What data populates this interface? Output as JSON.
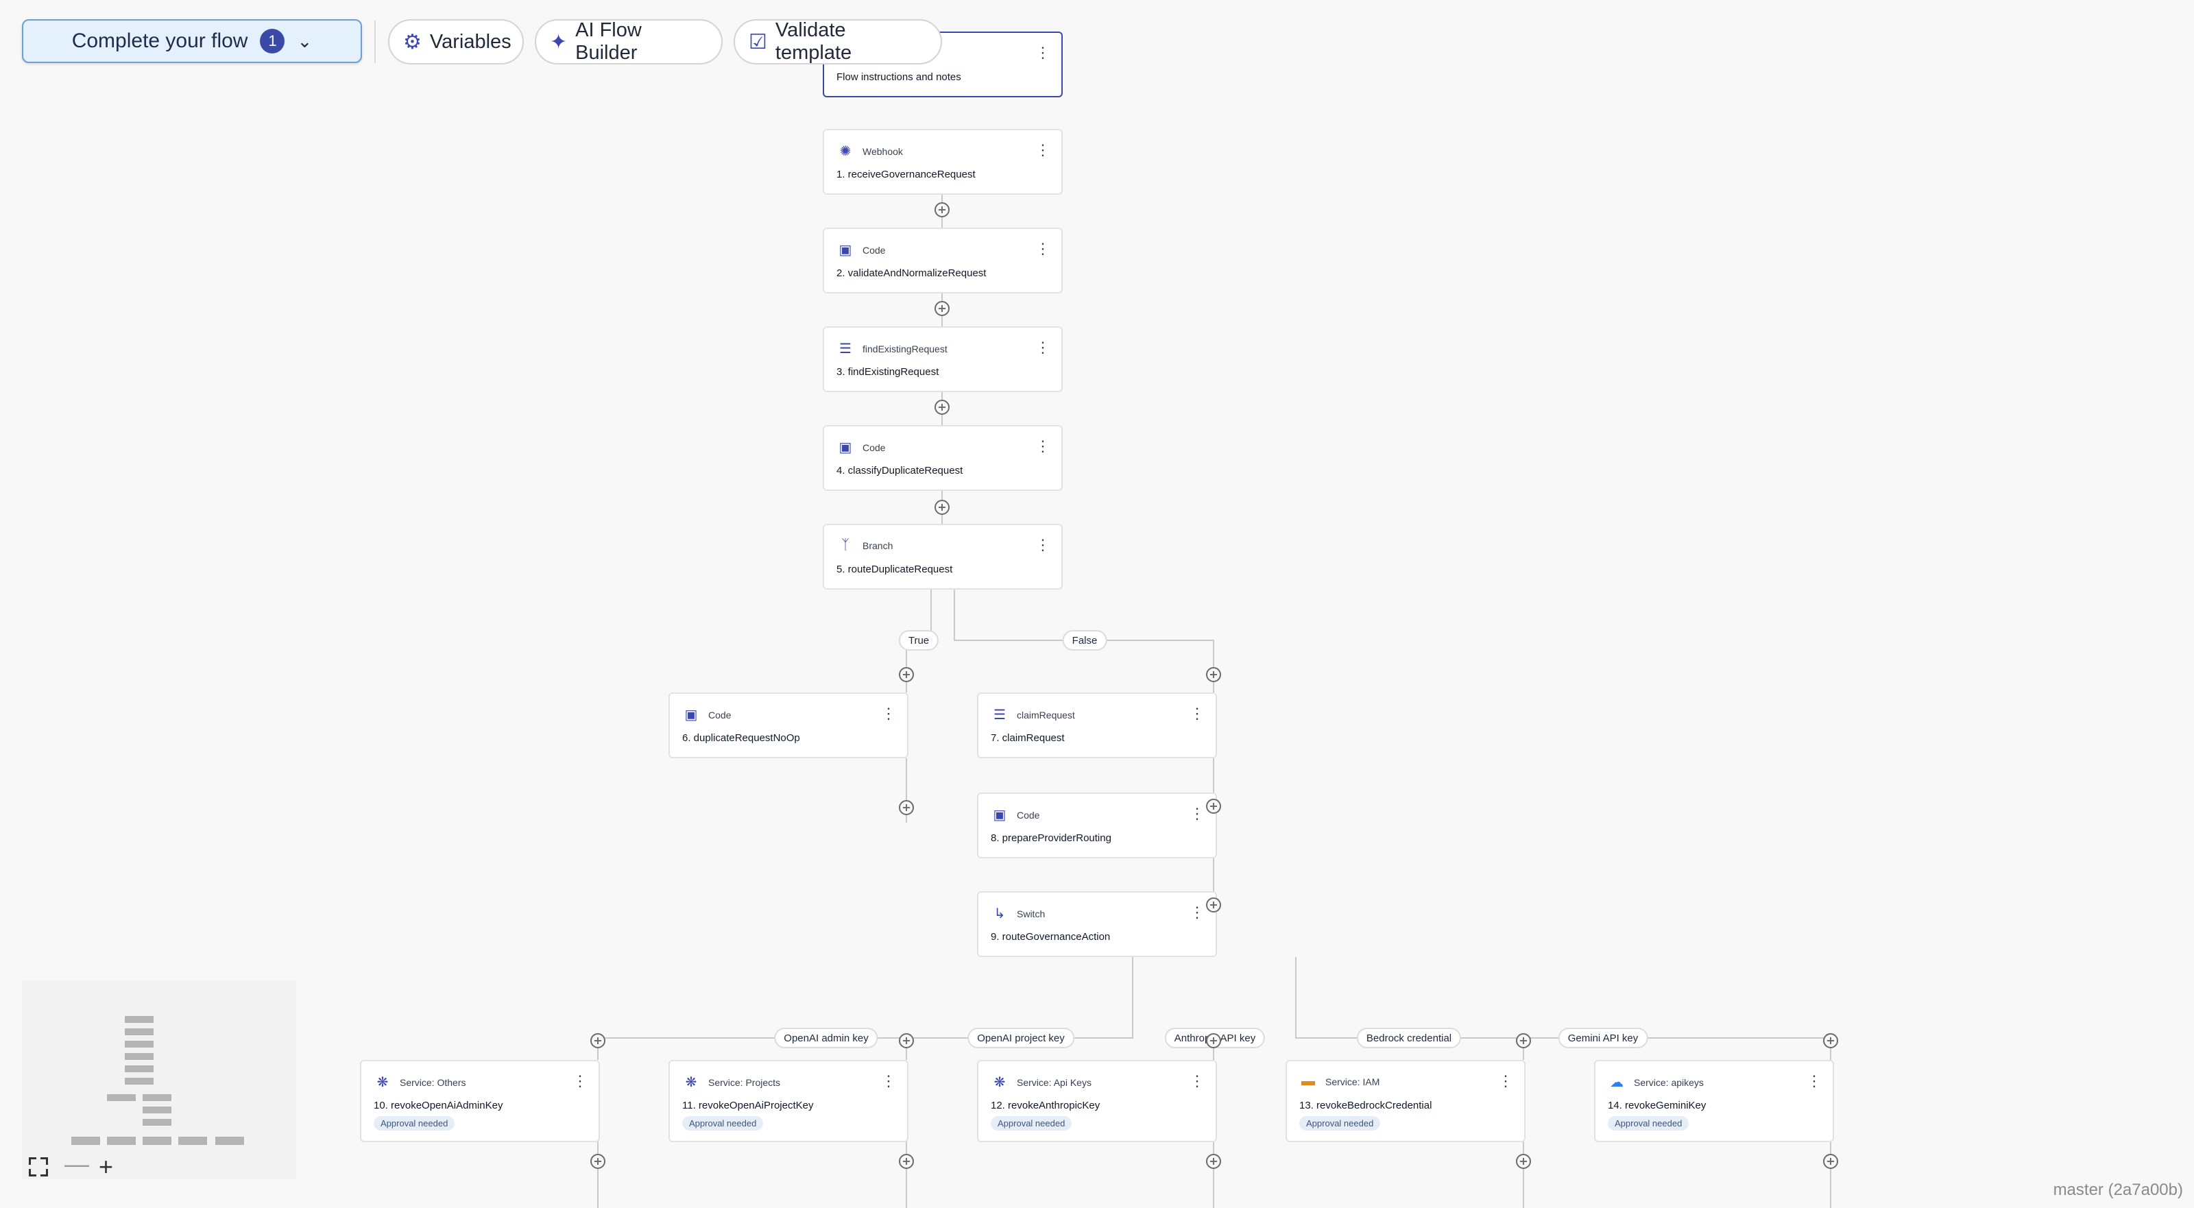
{
  "toolbar": {
    "complete_label": "Complete your flow",
    "complete_count": "1",
    "variables_label": "Variables",
    "ai_builder_label": "AI Flow Builder",
    "validate_label": "Validate template"
  },
  "notes_node": {
    "text": "Flow instructions and notes"
  },
  "nodes": [
    {
      "type": "Webhook",
      "name": "1. receiveGovernanceRequest"
    },
    {
      "type": "Code",
      "name": "2. validateAndNormalizeRequest"
    },
    {
      "type": "findExistingRequest",
      "name": "3. findExistingRequest"
    },
    {
      "type": "Code",
      "name": "4. classifyDuplicateRequest"
    },
    {
      "type": "Branch",
      "name": "5. routeDuplicateRequest"
    },
    {
      "type": "Code",
      "name": "6. duplicateRequestNoOp"
    },
    {
      "type": "claimRequest",
      "name": "7. claimRequest"
    },
    {
      "type": "Code",
      "name": "8. prepareProviderRouting"
    },
    {
      "type": "Switch",
      "name": "9. routeGovernanceAction"
    },
    {
      "type": "Service: Others",
      "name": "10. revokeOpenAiAdminKey",
      "badge": "Approval needed"
    },
    {
      "type": "Service: Projects",
      "name": "11. revokeOpenAiProjectKey",
      "badge": "Approval needed"
    },
    {
      "type": "Service: Api Keys",
      "name": "12. revokeAnthropicKey",
      "badge": "Approval needed"
    },
    {
      "type": "Service: IAM",
      "name": "13. revokeBedrockCredential",
      "badge": "Approval needed"
    },
    {
      "type": "Service: apikeys",
      "name": "14. revokeGeminiKey",
      "badge": "Approval needed"
    }
  ],
  "edge_labels": {
    "true": "True",
    "false": "False",
    "openai_admin": "OpenAI admin key",
    "openai_project": "OpenAI project key",
    "anthropic": "Anthropic API key",
    "bedrock": "Bedrock credential",
    "gemini": "Gemini API key"
  },
  "footer": {
    "branch": "master (2a7a00b)"
  },
  "colors": {
    "accent": "#3b46b0",
    "complete_bg": "#e4f0fb",
    "canvas": "#f8f8f8"
  }
}
